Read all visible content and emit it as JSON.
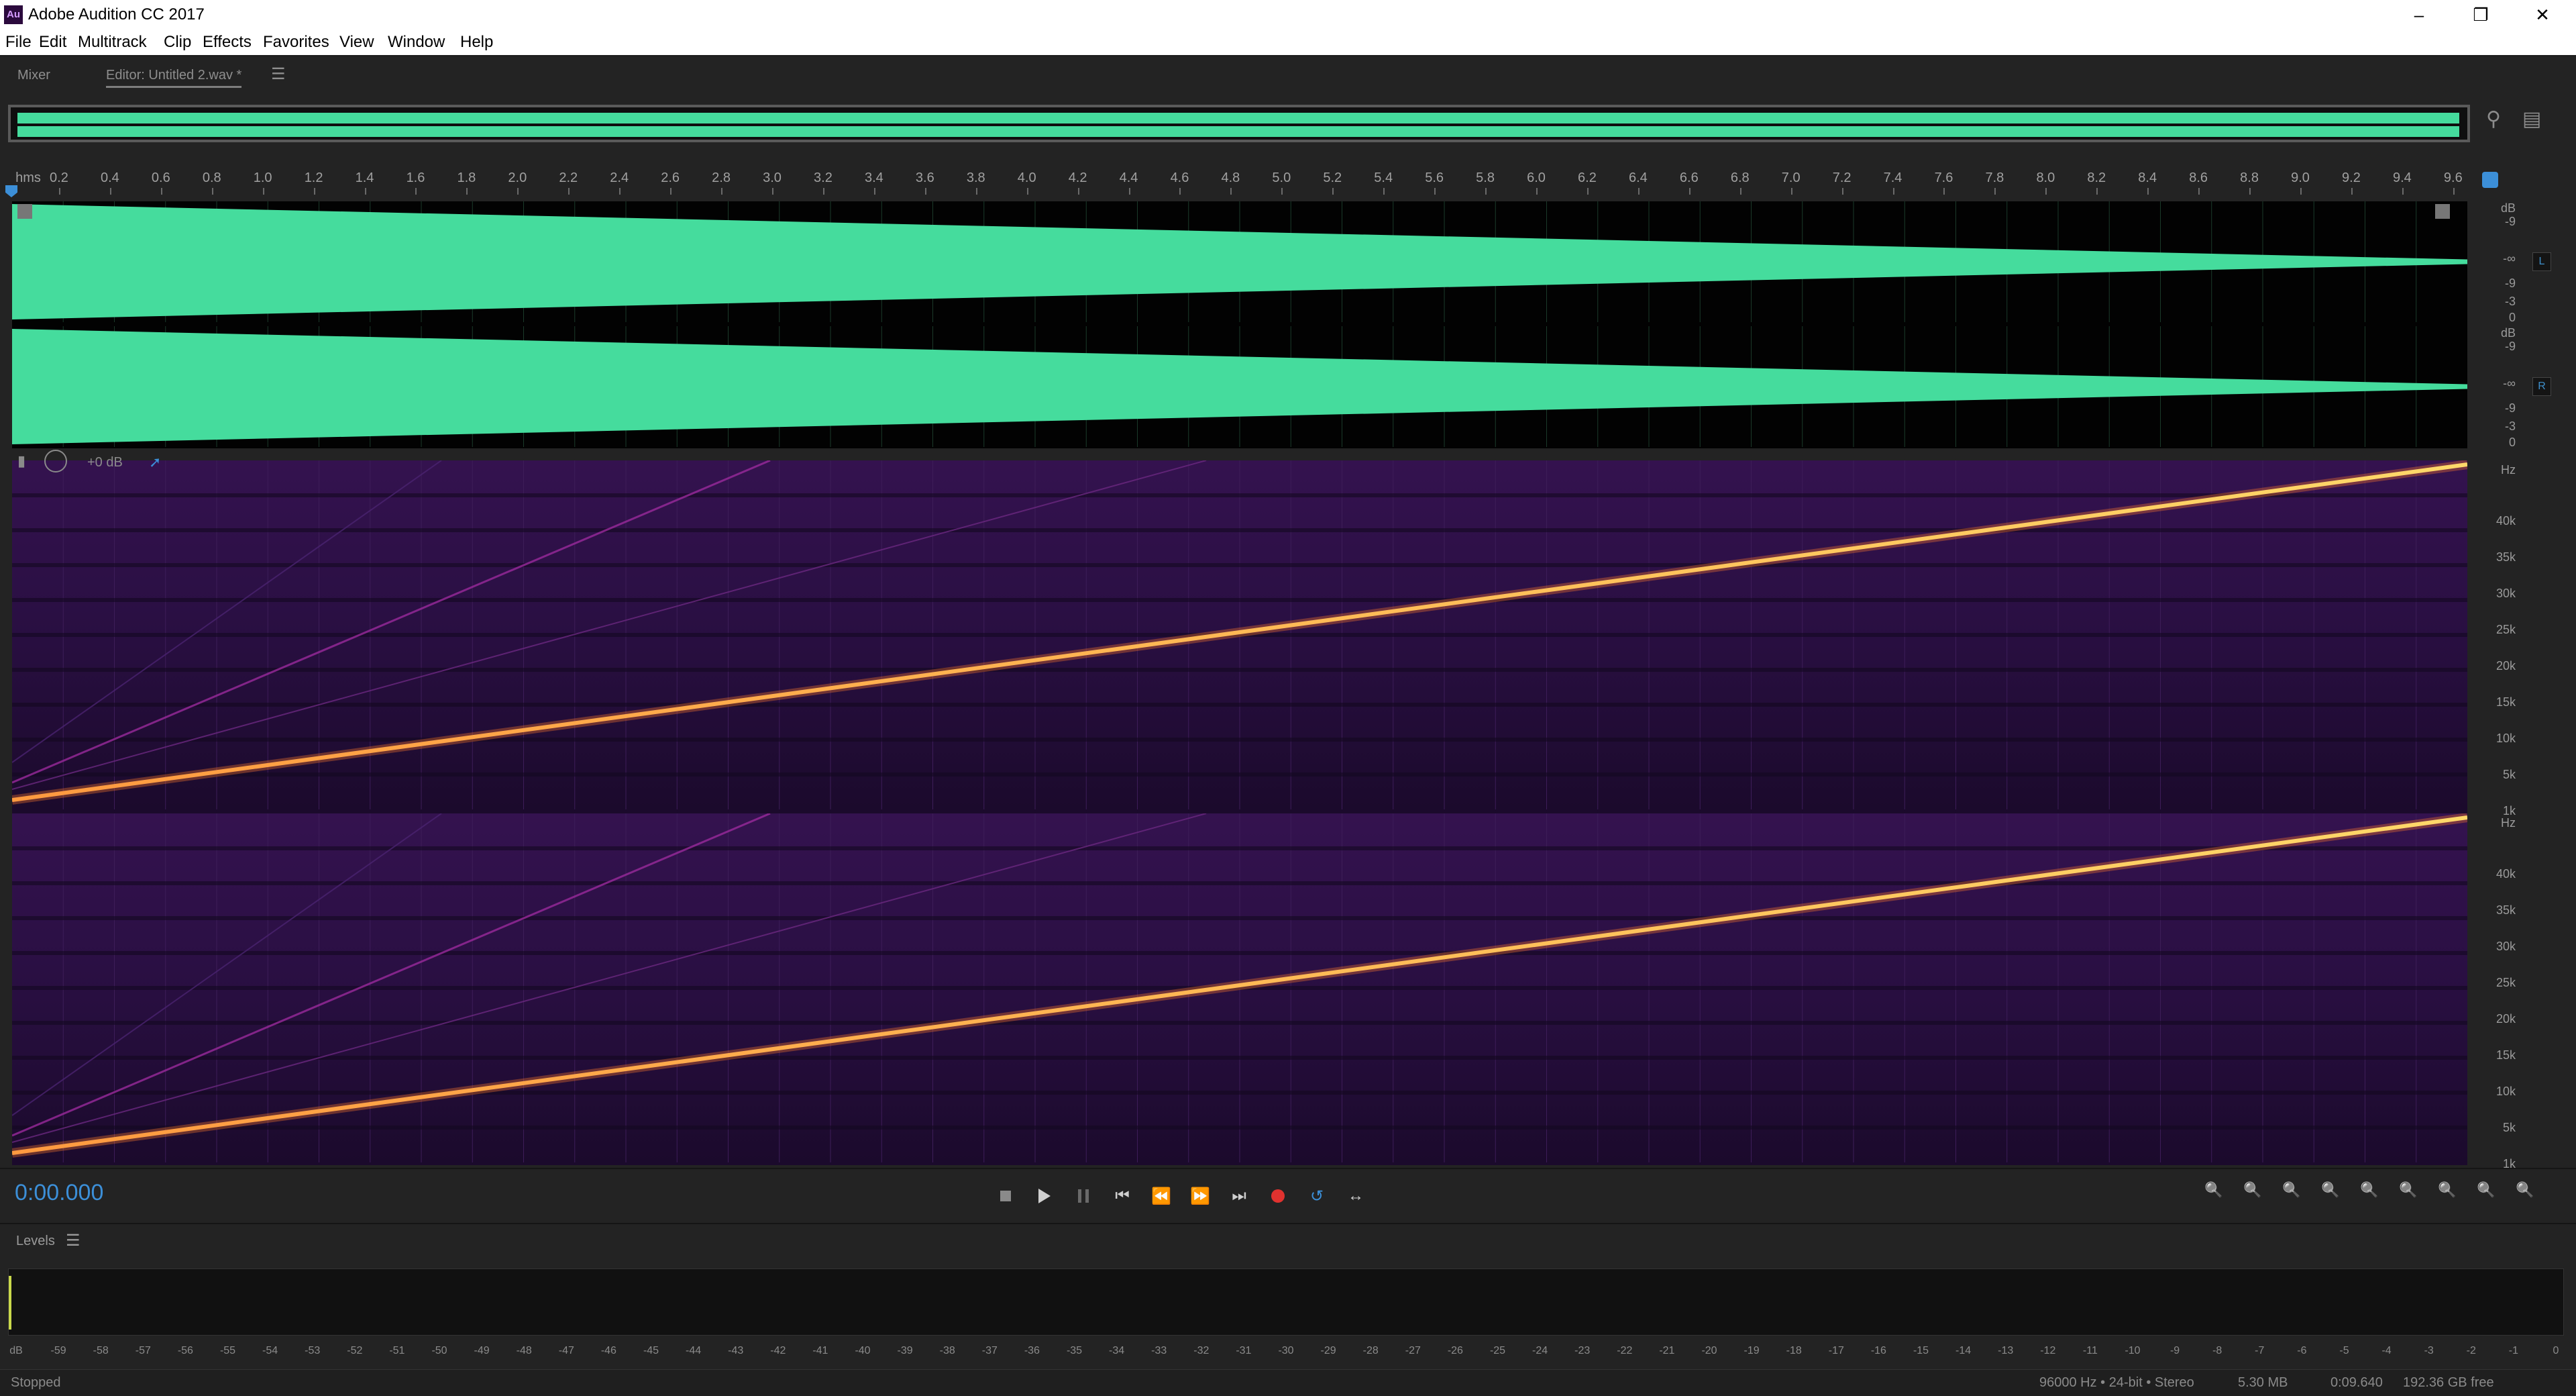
{
  "window": {
    "title": "Adobe Audition CC 2017",
    "icon_text": "Au",
    "controls": [
      "minimize",
      "restore",
      "close"
    ]
  },
  "menu": [
    "File",
    "Edit",
    "Multitrack",
    "Clip",
    "Effects",
    "Favorites",
    "View",
    "Window",
    "Help"
  ],
  "tabs": {
    "mixer": "Mixer",
    "editor": "Editor: Untitled 2.wav *"
  },
  "ruler": {
    "unit_label": "hms",
    "labels": [
      "0.2",
      "0.4",
      "0.6",
      "0.8",
      "1.0",
      "1.2",
      "1.4",
      "1.6",
      "1.8",
      "2.0",
      "2.2",
      "2.4",
      "2.6",
      "2.8",
      "3.0",
      "3.2",
      "3.4",
      "3.6",
      "3.8",
      "4.0",
      "4.2",
      "4.4",
      "4.6",
      "4.8",
      "5.0",
      "5.2",
      "5.4",
      "5.6",
      "5.8",
      "6.0",
      "6.2",
      "6.4",
      "6.6",
      "6.8",
      "7.0",
      "7.2",
      "7.4",
      "7.6",
      "7.8",
      "8.0",
      "8.2",
      "8.4",
      "8.6",
      "8.8",
      "9.0",
      "9.2",
      "9.4",
      "9.6"
    ]
  },
  "waveform": {
    "scale_labels": [
      "dB",
      "-9",
      "-∞",
      "-9",
      "-3",
      "0"
    ],
    "channels": [
      "L",
      "R"
    ],
    "amplitude_start": 1.0,
    "amplitude_end": 0.04,
    "color": "#45dc9d"
  },
  "spectral": {
    "gain_label": "+0 dB",
    "scale_labels": [
      "Hz",
      "40k",
      "35k",
      "30k",
      "25k",
      "20k",
      "15k",
      "10k",
      "5k",
      "1k"
    ],
    "sweep_color": "#ffc85a"
  },
  "transport": {
    "time": "0:00.000",
    "buttons": [
      "stop",
      "play",
      "pause",
      "go-to-start",
      "rewind",
      "fast-forward",
      "go-to-end",
      "record",
      "loop",
      "skip-selection"
    ],
    "zoom_buttons": [
      "zoom-in-amplitude",
      "zoom-out-amplitude",
      "zoom-in-time",
      "zoom-out-time",
      "zoom-to-selection",
      "zoom-full",
      "zoom-in-left",
      "zoom-in-right",
      "zoom-out-full"
    ]
  },
  "levels": {
    "label": "Levels",
    "scale": [
      "dB",
      "-59",
      "-58",
      "-57",
      "-56",
      "-55",
      "-54",
      "-53",
      "-52",
      "-51",
      "-50",
      "-49",
      "-48",
      "-47",
      "-46",
      "-45",
      "-44",
      "-43",
      "-42",
      "-41",
      "-40",
      "-39",
      "-38",
      "-37",
      "-36",
      "-35",
      "-34",
      "-33",
      "-32",
      "-31",
      "-30",
      "-29",
      "-28",
      "-27",
      "-26",
      "-25",
      "-24",
      "-23",
      "-22",
      "-21",
      "-20",
      "-19",
      "-18",
      "-17",
      "-16",
      "-15",
      "-14",
      "-13",
      "-12",
      "-11",
      "-10",
      "-9",
      "-8",
      "-7",
      "-6",
      "-5",
      "-4",
      "-3",
      "-2",
      "-1",
      "0"
    ]
  },
  "status": {
    "state": "Stopped",
    "sample_info": "96000 Hz • 24-bit • Stereo",
    "file_size": "5.30 MB",
    "duration": "0:09.640",
    "free_space": "192.36 GB free"
  },
  "colors": {
    "accent_blue": "#3c8fd8",
    "record_red": "#e0322f",
    "waveform_green": "#45dc9d"
  }
}
